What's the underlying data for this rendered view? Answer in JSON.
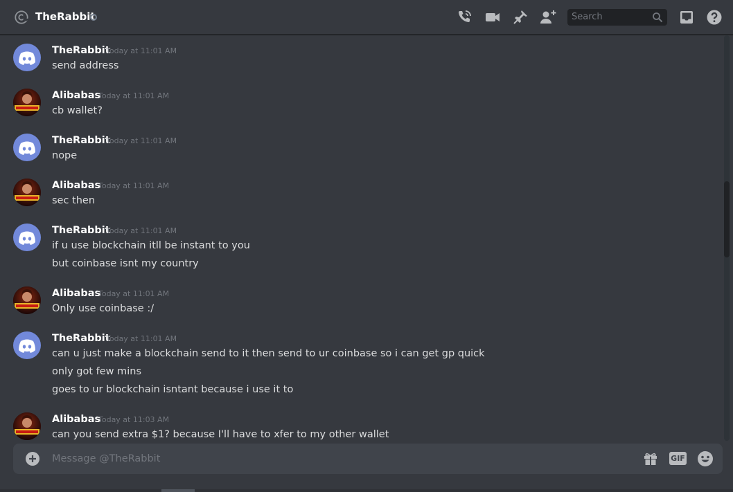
{
  "header": {
    "title": "TheRabbit",
    "search_placeholder": "Search",
    "icons": [
      "at-icon",
      "status-dot",
      "voice-call-icon",
      "video-call-icon",
      "pin-icon",
      "add-friend-icon",
      "search-icon",
      "inbox-icon",
      "help-icon"
    ]
  },
  "messages": [
    {
      "author": "TheRabbit",
      "timestamp": "Today at 11:01 AM",
      "lines": [
        "send address"
      ]
    },
    {
      "author": "Alibabas",
      "timestamp": "Today at 11:01 AM",
      "lines": [
        "cb wallet?"
      ]
    },
    {
      "author": "TheRabbit",
      "timestamp": "Today at 11:01 AM",
      "lines": [
        "nope"
      ]
    },
    {
      "author": "Alibabas",
      "timestamp": "Today at 11:01 AM",
      "lines": [
        "sec then"
      ]
    },
    {
      "author": "TheRabbit",
      "timestamp": "Today at 11:01 AM",
      "lines": [
        "if u use blockchain itll be instant to you",
        "but coinbase isnt my country"
      ]
    },
    {
      "author": "Alibabas",
      "timestamp": "Today at 11:01 AM",
      "lines": [
        "Only use coinbase :/"
      ]
    },
    {
      "author": "TheRabbit",
      "timestamp": "Today at 11:01 AM",
      "lines": [
        "can u just make a blockchain send to it then send to ur coinbase so i can get gp quick",
        "only got few mins",
        "goes to ur blockchain isntant because i use it to"
      ]
    },
    {
      "author": "Alibabas",
      "timestamp": "Today at 11:03 AM",
      "lines": [
        "can you send extra $1? because I'll have to xfer to my other wallet"
      ]
    }
  ],
  "composer": {
    "placeholder": "Message @TheRabbit",
    "gif_label": "GIF"
  },
  "colors": {
    "background": "#36393f",
    "composer": "#40444b",
    "blurple": "#7289da",
    "username": "#ffffff",
    "timestamp": "#72767d",
    "text": "#dcddde"
  }
}
